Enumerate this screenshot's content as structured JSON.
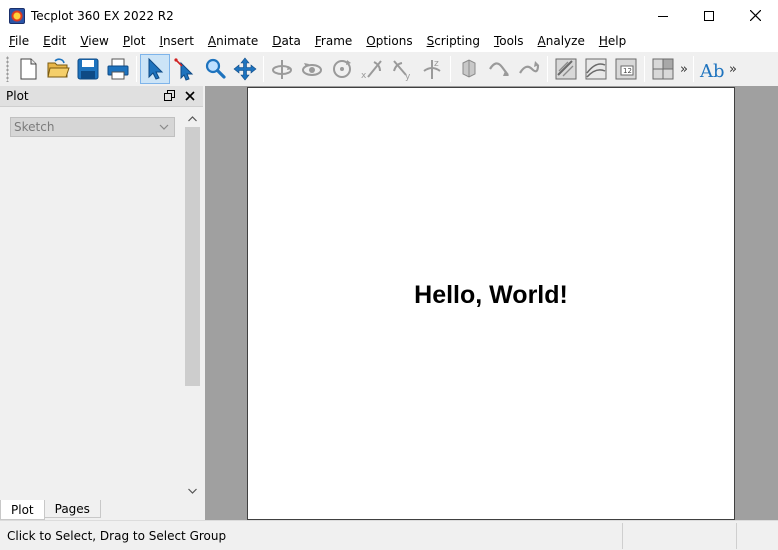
{
  "window": {
    "title": "Tecplot 360 EX 2022 R2"
  },
  "menu": [
    {
      "label": "File",
      "u": "F",
      "rest": "ile"
    },
    {
      "label": "Edit",
      "u": "E",
      "rest": "dit"
    },
    {
      "label": "View",
      "u": "V",
      "rest": "iew"
    },
    {
      "label": "Plot",
      "u": "P",
      "rest": "lot"
    },
    {
      "label": "Insert",
      "u": "I",
      "rest": "nsert"
    },
    {
      "label": "Animate",
      "u": "A",
      "rest": "nimate"
    },
    {
      "label": "Data",
      "u": "D",
      "rest": "ata"
    },
    {
      "label": "Frame",
      "u": "F",
      "rest": "rame"
    },
    {
      "label": "Options",
      "u": "O",
      "rest": "ptions"
    },
    {
      "label": "Scripting",
      "u": "S",
      "rest": "cripting"
    },
    {
      "label": "Tools",
      "u": "T",
      "rest": "ools"
    },
    {
      "label": "Analyze",
      "u": "A",
      "rest": "nalyze"
    },
    {
      "label": "Help",
      "u": "H",
      "rest": "elp"
    }
  ],
  "toolbar": {
    "more1": "»",
    "more2": "»",
    "ab_label": "Ab",
    "accent": "#1e73be"
  },
  "panel": {
    "title": "Plot",
    "dropdown_value": "Sketch",
    "tabs": [
      "Plot",
      "Pages"
    ]
  },
  "paper": {
    "text": "Hello, World!"
  },
  "status": {
    "text": "Click to Select, Drag to Select Group"
  }
}
